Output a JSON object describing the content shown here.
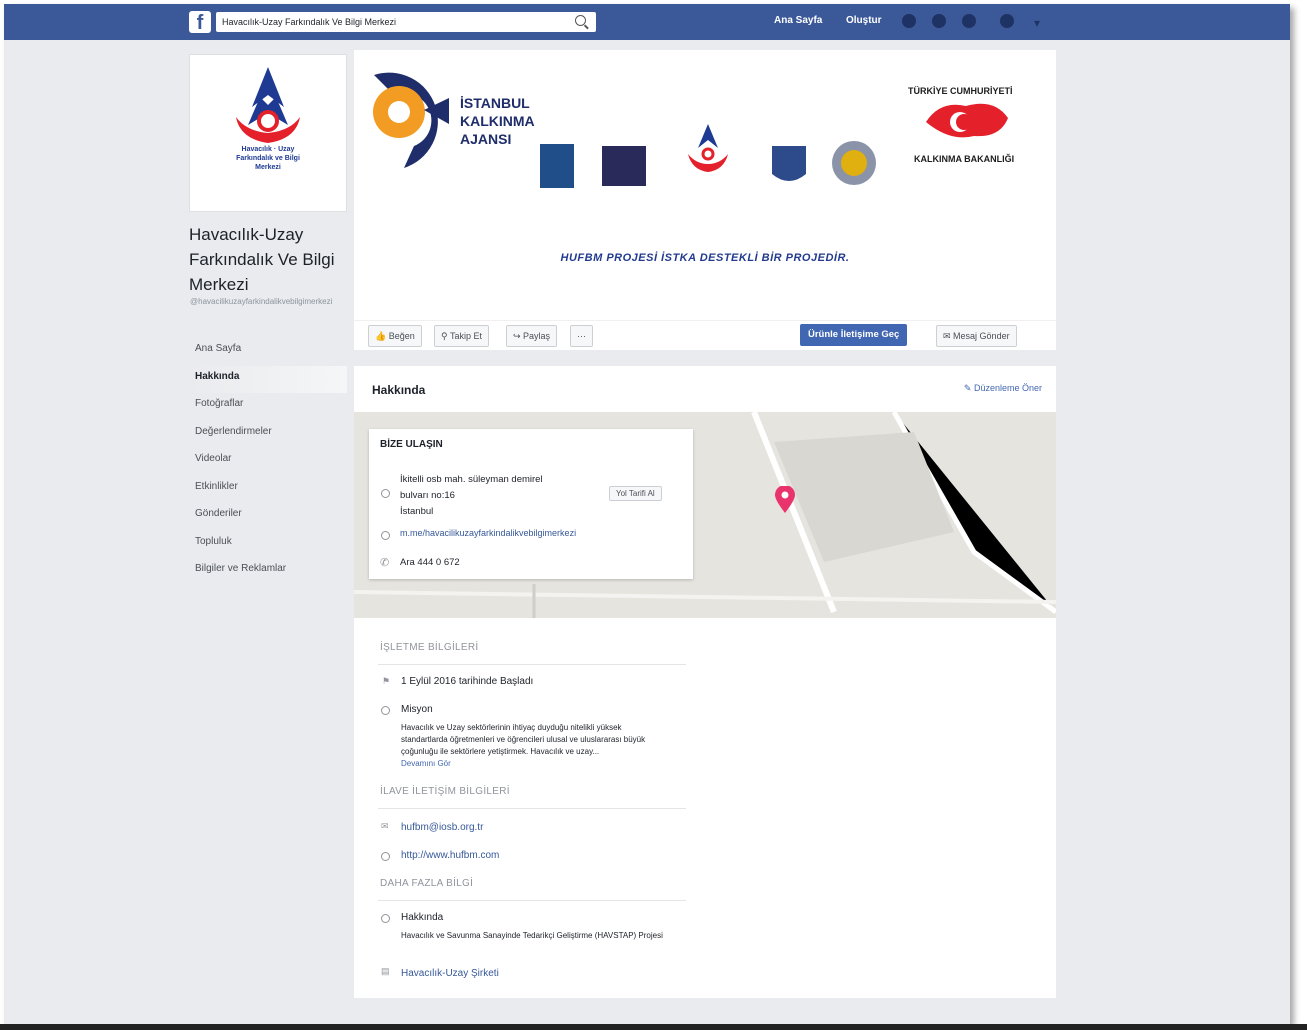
{
  "topbar": {
    "search_value": "Havacılık-Uzay Farkındalık Ve Bilgi Merkezi",
    "nav_home": "Ana Sayfa",
    "nav_create": "Oluştur"
  },
  "profile": {
    "logo_caption": "Havacılık · Uzay Farkındalık ve Bilgi Merkezi",
    "page_name": "Havacılık-Uzay Farkındalık Ve Bilgi Merkezi",
    "handle": "@havacilikuzayfarkindalikvebilgimerkezi"
  },
  "sidebar": {
    "items": [
      {
        "label": "Ana Sayfa"
      },
      {
        "label": "Hakkında"
      },
      {
        "label": "Fotoğraflar"
      },
      {
        "label": "Değerlendirmeler"
      },
      {
        "label": "Videolar"
      },
      {
        "label": "Etkinlikler"
      },
      {
        "label": "Gönderiler"
      },
      {
        "label": "Topluluk"
      },
      {
        "label": "Bilgiler ve Reklamlar"
      }
    ]
  },
  "cover": {
    "istanbul_logo_text": "İSTANBUL KALKINMA AJANSI",
    "ministry_text": "TÜRKİYE CUMHURİYETİ KALKINMA BAKANLIĞI",
    "caption": "HUFBM PROJESİ İSTKA DESTEKLİ BİR PROJEDİR."
  },
  "actions": {
    "like": "Beğen",
    "follow": "Takip Et",
    "share": "Paylaş",
    "more": "···",
    "primary": "Ürünle İletişime Geç",
    "message": "Mesaj Gönder"
  },
  "about": {
    "title": "Hakkında",
    "suggest_edit": "Düzenleme Öner",
    "contact_title": "BİZE ULAŞIN",
    "address_lines": [
      "İkitelli osb mah. süleyman demirel",
      "bulvarı no:16",
      "İstanbul"
    ],
    "directions_button": "Yol Tarifi Al",
    "messenger_link": "m.me/havacilikuzayfarkindalikvebilgimerkezi",
    "phone": "Ara 444 0 672",
    "business_title": "İŞLETME BİLGİLERİ",
    "founded": "1 Eylül 2016 tarihinde Başladı",
    "mission_label": "Misyon",
    "mission_text": "Havacılık ve Uzay sektörlerinin ihtiyaç duyduğu nitelikli yüksek standartlarda öğretmenleri ve öğrencileri ulusal ve uluslararası büyük çoğunluğu ile sektörlere yetiştirmek. Havacılık ve uzay...",
    "see_more": "Devamını Gör",
    "extra_contact_title": "İLAVE İLETİŞİM BİLGİLERİ",
    "email": "hufbm@iosb.org.tr",
    "website": "http://www.hufbm.com",
    "more_info_title": "DAHA FAZLA BİLGİ",
    "about_label": "Hakkında",
    "about_text": "Havacılık ve Savunma Sanayinde Tedarikçi Geliştirme (HAVSTAP) Projesi",
    "category": "Havacılık-Uzay Şirketi"
  }
}
